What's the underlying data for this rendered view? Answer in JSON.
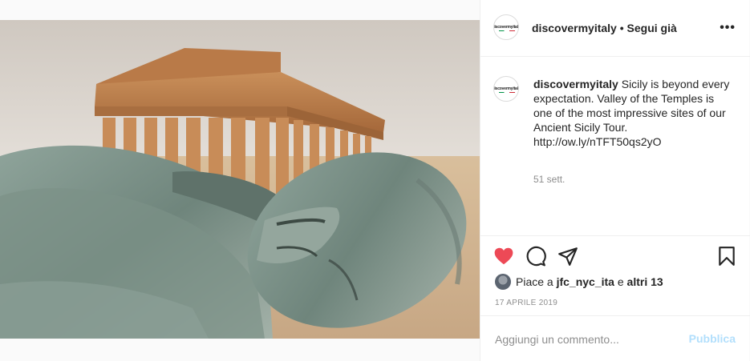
{
  "post": {
    "username": "discovermyitaly",
    "follow_status": "Segui già",
    "header_line": "discovermyitaly • Segui già",
    "avatar_logo": "discovermyitaly",
    "caption_username": "discovermyitaly",
    "caption_text": "Sicily is beyond every expectation. Valley of the Temples is one of the most impressive sites of our Ancient Sicily Tour. http://ow.ly/nTFT50qs2yO",
    "time_ago": "51 sett.",
    "liked": true
  },
  "likes": {
    "prefix": "Piace a",
    "user": "jfc_nyc_ita",
    "joiner": "e",
    "others": "altri 13"
  },
  "date": "17 APRILE 2019",
  "comment": {
    "placeholder": "Aggiungi un commento...",
    "publish_label": "Pubblica"
  },
  "icons": {
    "more": "more-options-icon",
    "like": "heart-filled-icon",
    "comment": "comment-bubble-icon",
    "share": "paper-plane-icon",
    "save": "bookmark-icon"
  },
  "colors": {
    "like": "#ed4956",
    "publish_disabled": "#b2dffc",
    "muted_text": "#8e8e8e"
  }
}
